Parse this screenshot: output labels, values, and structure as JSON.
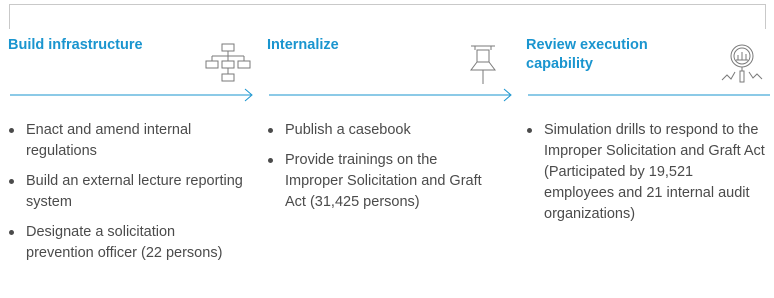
{
  "colors": {
    "accent": "#1a95cf",
    "text": "#4b4b4b",
    "frame": "#c9c9c9"
  },
  "columns": [
    {
      "title": "Build infrastructure",
      "icon": "org-chart-icon",
      "bullets": [
        "Enact and amend internal regulations",
        "Build an external lecture reporting system",
        "Designate a solicitation prevention officer (22 persons)"
      ]
    },
    {
      "title": "Internalize",
      "icon": "pushpin-icon",
      "bullets": [
        "Publish a casebook",
        "Provide trainings on the Improper Solicitation and Graft Act (31,425 persons)"
      ]
    },
    {
      "title": "Review execution capability",
      "icon": "magnifier-chart-icon",
      "bullets": [
        "Simulation drills to respond to the Improper Solicitation and Graft Act (Participated by 19,521 employees and 21 internal audit organizations)"
      ]
    }
  ]
}
